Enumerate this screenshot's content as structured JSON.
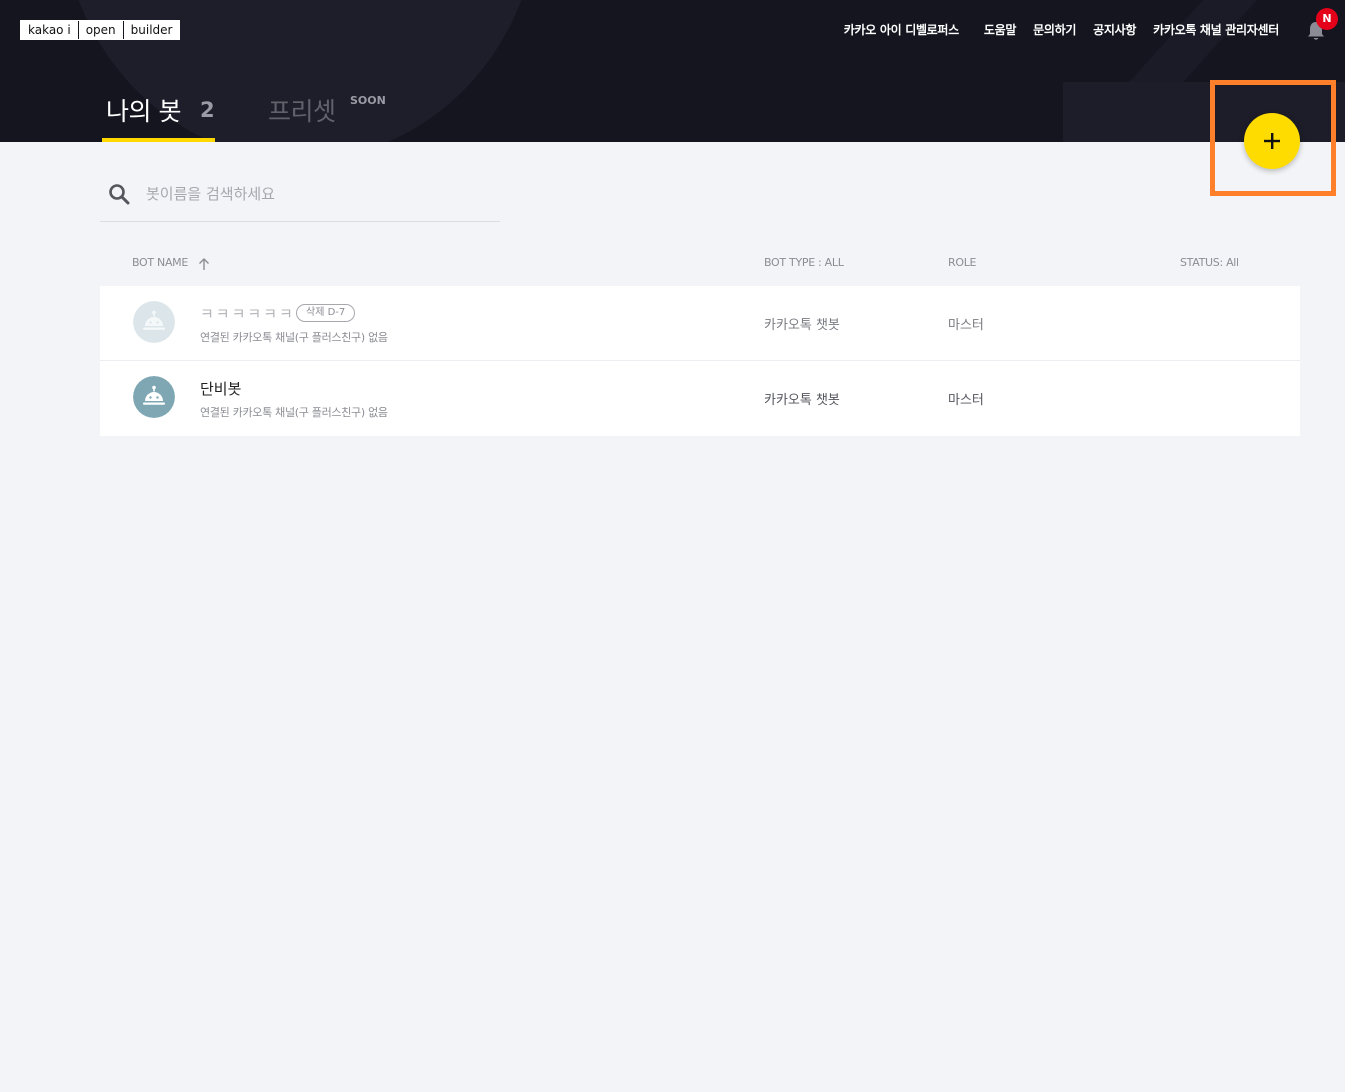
{
  "header": {
    "logo": [
      "kakao i",
      "open",
      "builder"
    ],
    "nav": [
      "카카오 아이 디벨로퍼스",
      "도움말",
      "문의하기",
      "공지사항",
      "카카오톡 채널 관리자센터"
    ],
    "notification_badge": "N",
    "tabs": {
      "my_bots_label": "나의 봇",
      "my_bots_count": "2",
      "preset_label": "프리셋",
      "preset_tag": "SOON"
    },
    "add_button_icon": "plus-icon",
    "accent_color": "#ffdc00"
  },
  "search": {
    "placeholder": "봇이름을 검색하세요"
  },
  "table": {
    "columns": {
      "bot_name": "BOT NAME",
      "bot_type": "BOT TYPE : ALL",
      "role": "ROLE",
      "status": "STATUS: All"
    },
    "rows": [
      {
        "name": "ㅋㅋㅋㅋㅋㅋ",
        "badge": "삭제 D-7",
        "sub": "연결된 카카오톡 채널(구 플러스친구) 없음",
        "type": "카카오톡 챗봇",
        "role": "마스터"
      },
      {
        "name": "단비봇",
        "sub": "연결된 카카오톡 채널(구 플러스친구) 없음",
        "type": "카카오톡 챗봇",
        "role": "마스터"
      }
    ]
  }
}
